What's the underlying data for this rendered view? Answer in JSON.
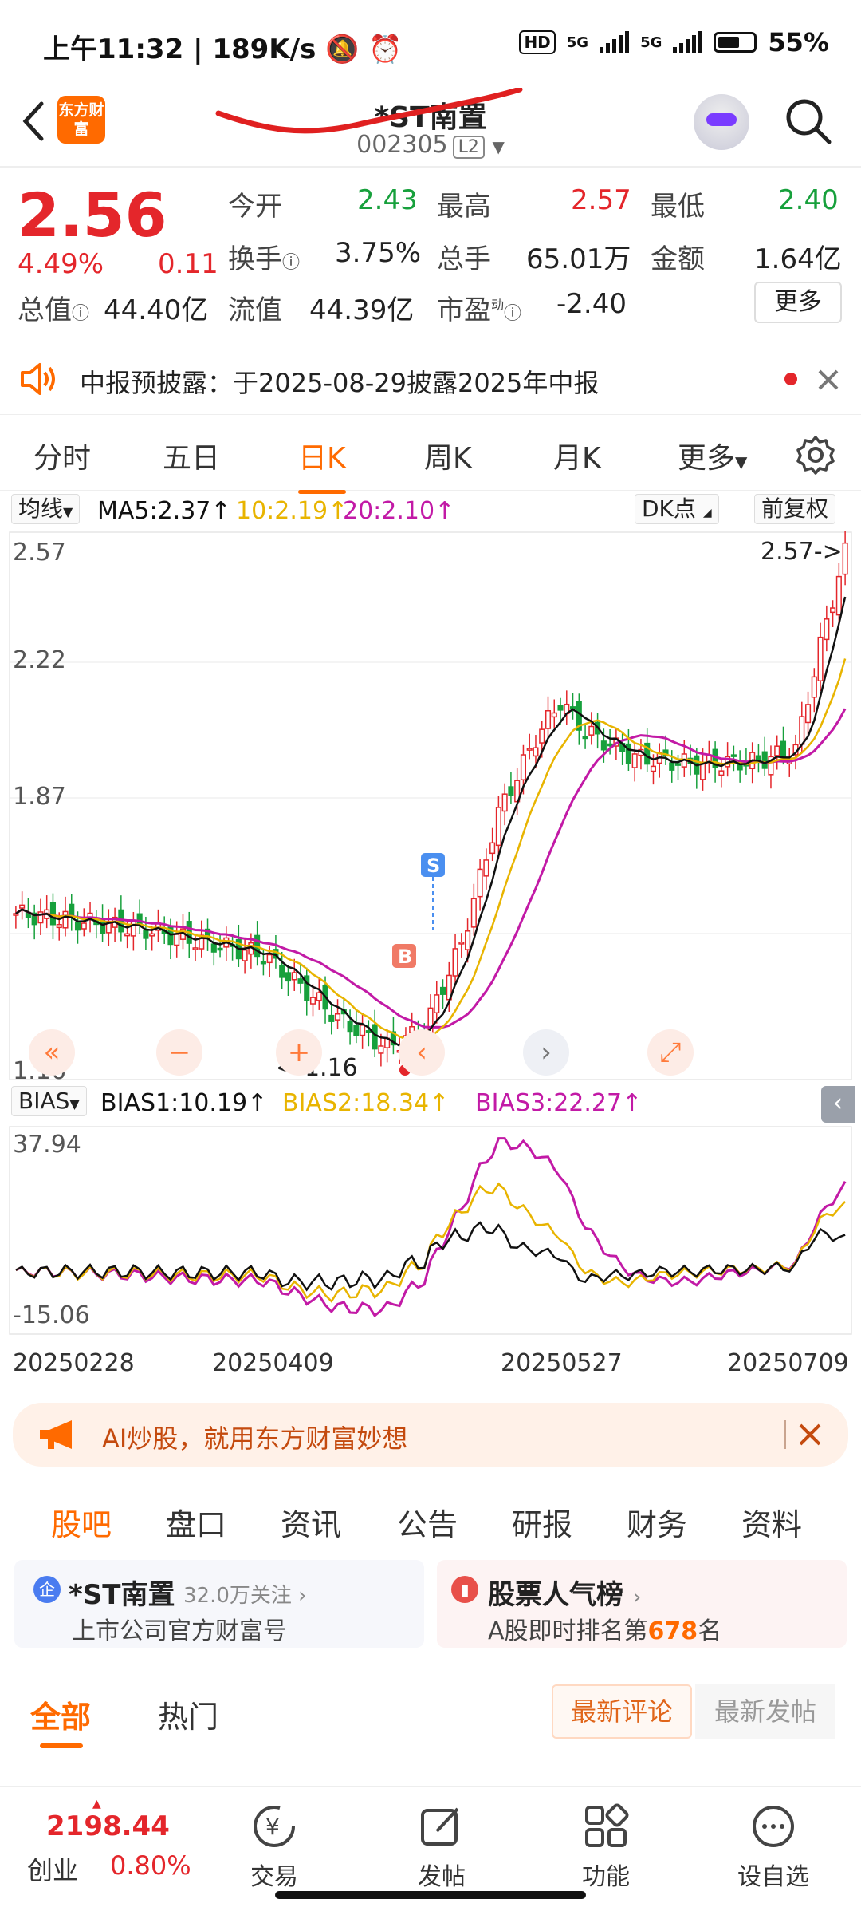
{
  "status_bar": {
    "time": "上午11:32",
    "speed": "189K/s",
    "hd": "HD",
    "net1": "5G",
    "net2": "5G",
    "battery": "55%"
  },
  "header": {
    "title": "*ST南置",
    "code": "002305",
    "level": "L2",
    "logo": "东方财富"
  },
  "quote": {
    "price": "2.56",
    "change_pct": "4.49%",
    "change": "0.11",
    "open_label": "今开",
    "open": "2.43",
    "high_label": "最高",
    "high": "2.57",
    "low_label": "最低",
    "low": "2.40",
    "turnover_label": "换手",
    "turnover": "3.75%",
    "volume_label": "总手",
    "volume": "65.01万",
    "amount_label": "金额",
    "amount": "1.64亿",
    "mktcap_label": "总值",
    "mktcap": "44.40亿",
    "float_label": "流值",
    "float_cap": "44.39亿",
    "pe_label": "市盈",
    "pe_sup": "动",
    "pe": "-2.40",
    "more": "更多"
  },
  "notice": {
    "text": "中报预披露：于2025-08-29披露2025年中报"
  },
  "tabs": [
    "分时",
    "五日",
    "日K",
    "周K",
    "月K",
    "更多"
  ],
  "active_tab": 2,
  "ma": {
    "selector": "均线",
    "ma5": "MA5:2.37",
    "ma10": "10:2.19",
    "ma20": "20:2.10",
    "dk": "DK点",
    "adjust": "前复权"
  },
  "price_axis": {
    "top": "2.57",
    "l2": "2.22",
    "l3": "1.87",
    "bottom": "1.16"
  },
  "markers": {
    "high_note": "2.57->",
    "low_note": "<-1.16",
    "buy": "B",
    "sell": "S"
  },
  "bias": {
    "selector": "BIAS",
    "b1": "BIAS1:10.19",
    "b2": "BIAS2:18.34",
    "b3": "BIAS3:22.27",
    "top": "37.94",
    "bottom": "-15.06"
  },
  "dates": [
    "20250228",
    "20250409",
    "20250527",
    "20250709"
  ],
  "ad": {
    "text": "AI炒股，就用东方财富妙想"
  },
  "section_tabs": [
    "股吧",
    "盘口",
    "资讯",
    "公告",
    "研报",
    "财务",
    "资料"
  ],
  "card1": {
    "badge": "企",
    "name": "*ST南置",
    "followers": "32.0万关注",
    "sub": "上市公司官方财富号"
  },
  "card2": {
    "name": "股票人气榜",
    "sub_pre": "A股即时排名第",
    "rank": "678",
    "sub_post": "名"
  },
  "sub_tabs": {
    "all": "全部",
    "hot": "热门",
    "latest_comment": "最新评论",
    "latest_post": "最新发帖"
  },
  "bottom": {
    "index_value": "2198.44",
    "index_name": "创业",
    "index_pct": "0.80%",
    "trade": "交易",
    "post": "发帖",
    "func": "功能",
    "watch": "设自选"
  },
  "colors": {
    "up": "#e4262b",
    "down": "#17a03c",
    "accent": "#ff6a00",
    "ma5": "#111111",
    "ma10": "#e8b400",
    "ma20": "#c21aa6"
  }
}
